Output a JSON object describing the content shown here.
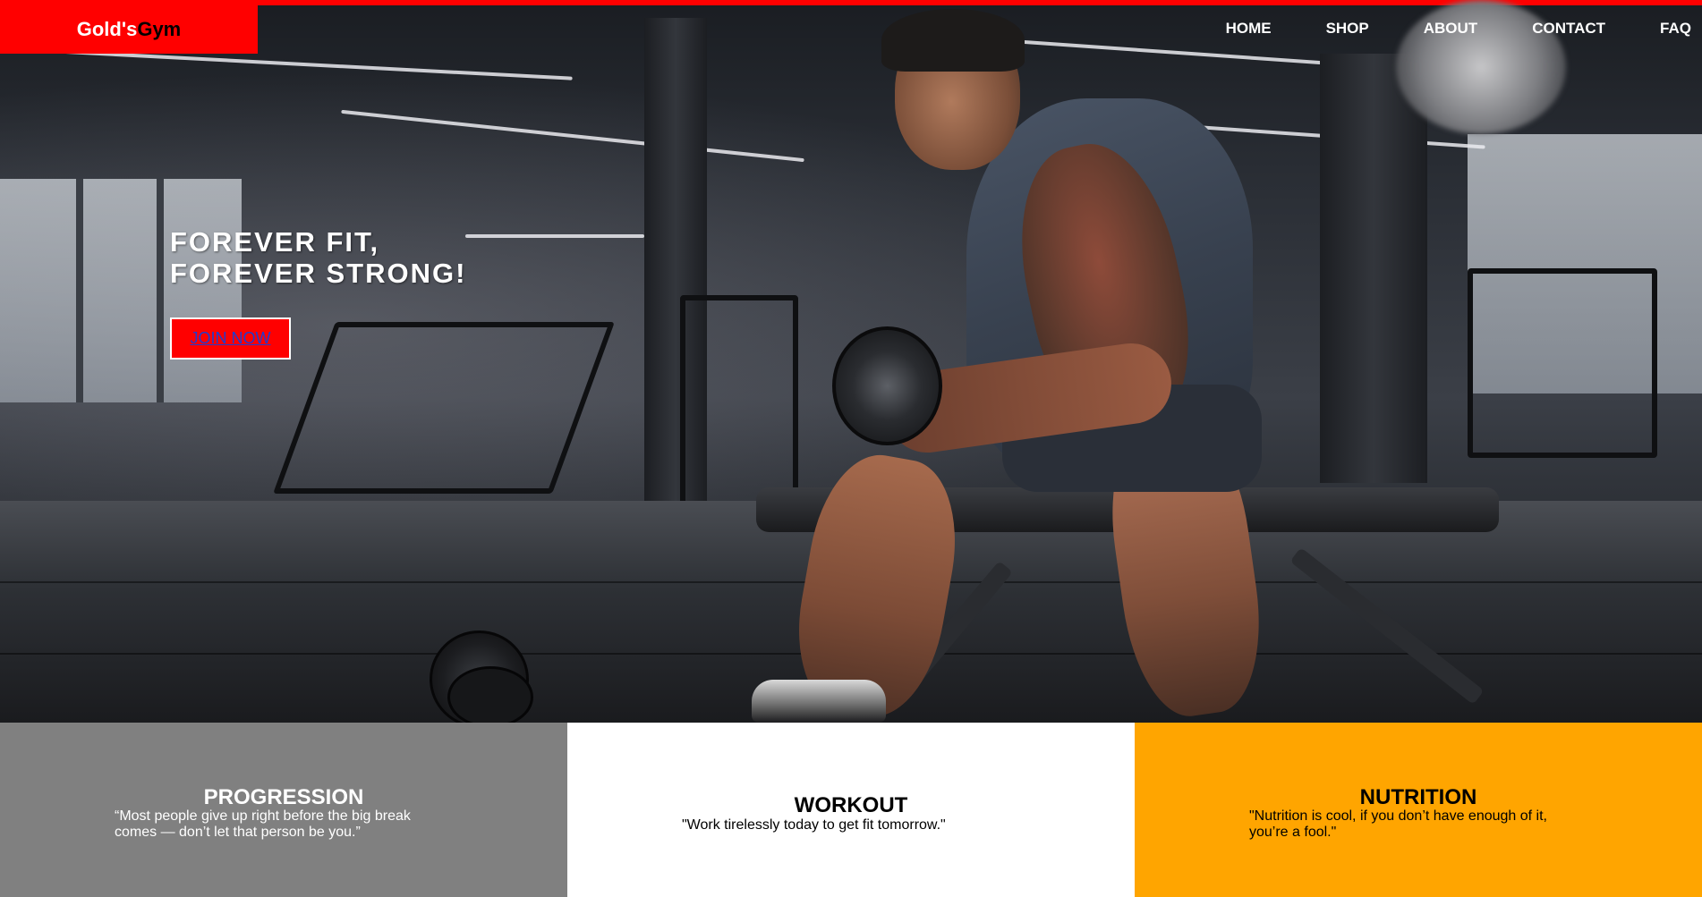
{
  "brand": {
    "logo_part_1": "Gold's",
    "logo_part_2": "Gym",
    "accent_color": "#ff0000"
  },
  "nav": {
    "items": [
      {
        "label": "HOME"
      },
      {
        "label": "SHOP"
      },
      {
        "label": "ABOUT"
      },
      {
        "label": "CONTACT"
      },
      {
        "label": "FAQ"
      }
    ]
  },
  "hero": {
    "headline_line_1": "FOREVER FIT,",
    "headline_line_2": "FOREVER STRONG!",
    "cta_label": "JOIN NOW"
  },
  "features": [
    {
      "title": "PROGRESSION",
      "quote_line_1": "“Most people give up right before the big break",
      "quote_line_2": "comes — don’t let that person be you.”",
      "bg_color": "#808080"
    },
    {
      "title": "WORKOUT",
      "quote_line_1": "\"Work tirelessly today to get fit tomorrow.\"",
      "bg_color": "#ffffff"
    },
    {
      "title": "NUTRITION",
      "quote_line_1": "\"Nutrition is cool, if you don’t have enough of it,",
      "quote_line_2": "you’re a fool.\"",
      "bg_color": "#ffa500"
    }
  ]
}
